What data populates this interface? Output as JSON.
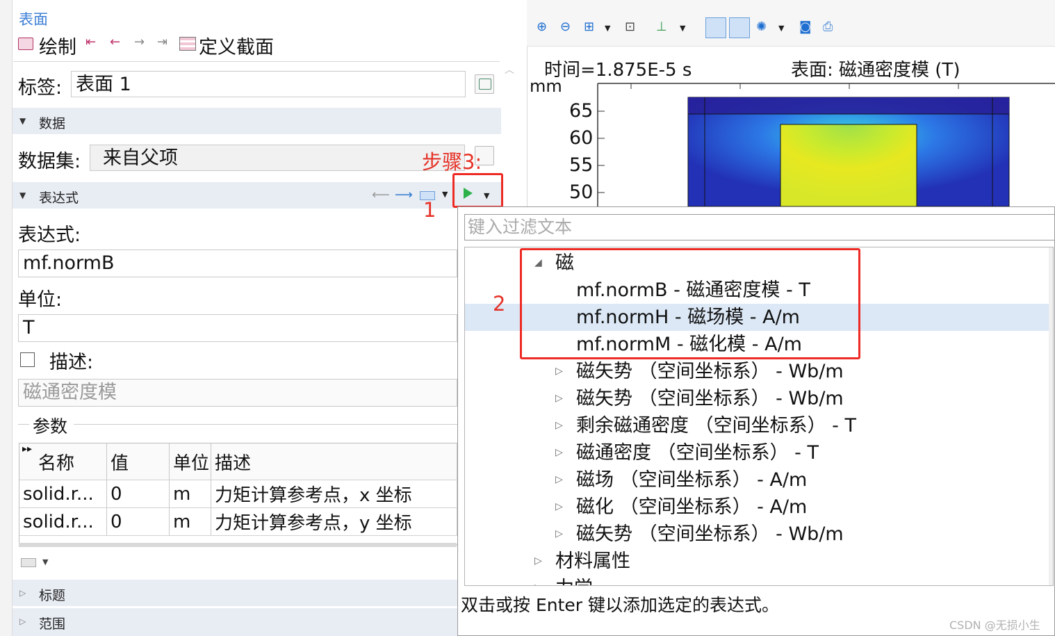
{
  "left_panel": {
    "top_link": "表面",
    "toolbar": {
      "plot_label": "绘制",
      "define_section_label": "定义截面"
    },
    "label_row": {
      "label": "标签:",
      "value": "表面 1"
    },
    "data_section": {
      "title": "数据",
      "dataset_label": "数据集:",
      "dataset_value": "来自父项"
    },
    "expression_section": {
      "title": "表达式",
      "expression_label": "表达式:",
      "expression_value": "mf.normB",
      "unit_label": "单位:",
      "unit_value": "T",
      "description_label": "描述:",
      "description_placeholder": "磁通密度模"
    },
    "params": {
      "title": "参数",
      "columns": [
        "名称",
        "值",
        "单位",
        "描述"
      ],
      "rows": [
        {
          "name": "solid.r...",
          "value": "0",
          "unit": "m",
          "desc": "力矩计算参考点，x 坐标"
        },
        {
          "name": "solid.r...",
          "value": "0",
          "unit": "m",
          "desc": "力矩计算参考点，y 坐标"
        }
      ]
    },
    "collapsed_sections": [
      "标题",
      "范围"
    ]
  },
  "graphics": {
    "time_label": "时间=1.875E-5 s",
    "surface_label": "表面: 磁通密度模 (T)",
    "axis_unit": "mm",
    "y_ticks": [
      "65",
      "60",
      "55",
      "50"
    ]
  },
  "annotations": {
    "step_label": "步骤3:",
    "marker1": "1",
    "marker2": "2",
    "accent_color": "#ee2a24"
  },
  "popup": {
    "filter_placeholder": "键入过滤文本",
    "tree": [
      {
        "text": "磁",
        "level": 0,
        "arrow": "expanded"
      },
      {
        "text": "mf.normB - 磁通密度模 - T",
        "level": 1,
        "arrow": "none"
      },
      {
        "text": "mf.normH - 磁场模 - A/m",
        "level": 1,
        "arrow": "none",
        "selected": true
      },
      {
        "text": "mf.normM - 磁化模 - A/m",
        "level": 1,
        "arrow": "none"
      },
      {
        "text": "磁矢势 （空间坐标系） - Wb/m",
        "level": 1,
        "arrow": "collapsed"
      },
      {
        "text": "磁矢势 （空间坐标系） - Wb/m",
        "level": 1,
        "arrow": "collapsed"
      },
      {
        "text": "剩余磁通密度 （空间坐标系） - T",
        "level": 1,
        "arrow": "collapsed"
      },
      {
        "text": "磁通密度 （空间坐标系） - T",
        "level": 1,
        "arrow": "collapsed"
      },
      {
        "text": "磁场 （空间坐标系） - A/m",
        "level": 1,
        "arrow": "collapsed"
      },
      {
        "text": "磁化 （空间坐标系） - A/m",
        "level": 1,
        "arrow": "collapsed"
      },
      {
        "text": "磁矢势 （空间坐标系） - Wb/m",
        "level": 1,
        "arrow": "collapsed"
      },
      {
        "text": "材料属性",
        "level": 0,
        "arrow": "collapsed"
      },
      {
        "text": "力学",
        "level": 0,
        "arrow": "collapsed"
      }
    ],
    "hint": "双击或按 Enter 键以添加选定的表达式。"
  },
  "watermark": "CSDN @无损小生"
}
